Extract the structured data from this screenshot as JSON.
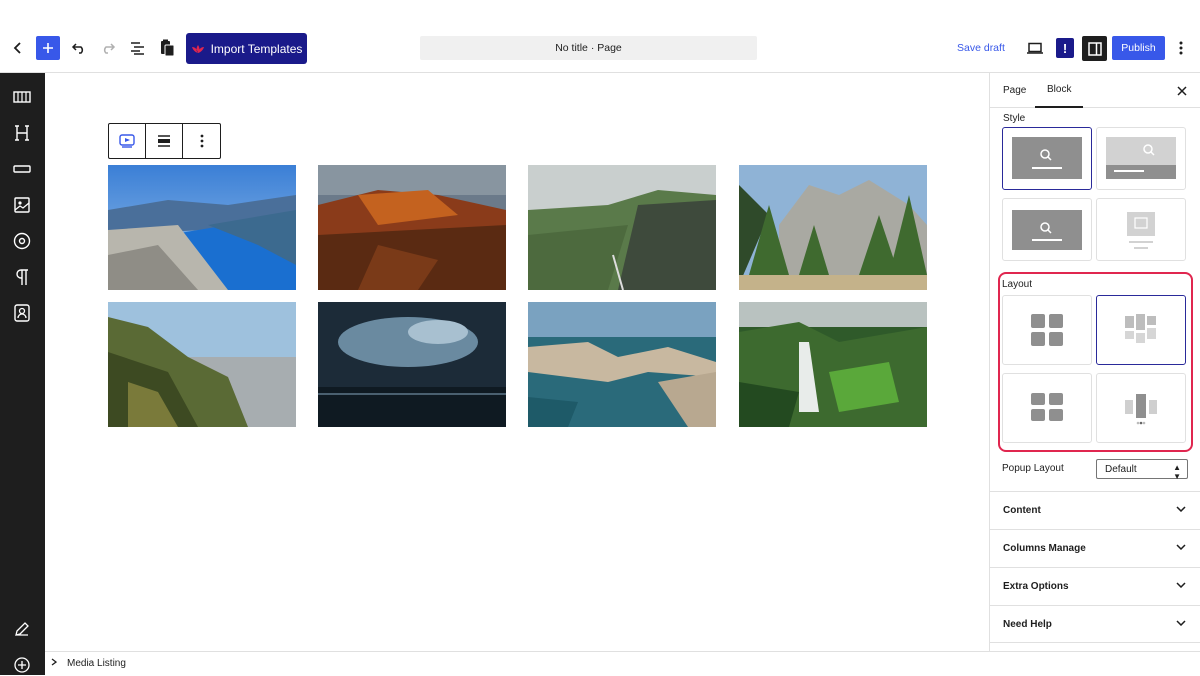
{
  "toolbar": {
    "import_label": "Import Templates",
    "doc_title": "No title · Page",
    "save_draft": "Save draft",
    "publish": "Publish",
    "exclaim": "!"
  },
  "panel": {
    "tabs": [
      "Page",
      "Block"
    ],
    "active_tab": "Block",
    "style_label": "Style",
    "layout_label": "Layout",
    "popup_layout_label": "Popup Layout",
    "popup_layout_value": "Default",
    "sections": [
      "Content",
      "Columns Manage",
      "Extra Options",
      "Need Help"
    ]
  },
  "footer": {
    "breadcrumb": "Media Listing"
  },
  "colors": {
    "accent": "#3858e9",
    "import_bg": "#1a1a8a",
    "highlight": "#e0264f",
    "sidebar": "#1e1e1e"
  },
  "gallery_images": [
    "fjord-cliff",
    "red-rock-canyon",
    "green-mountain-valley",
    "yosemite-forest",
    "coastal-sunset",
    "stormy-sea",
    "rocky-coast-aerial",
    "forest-waterfall"
  ]
}
